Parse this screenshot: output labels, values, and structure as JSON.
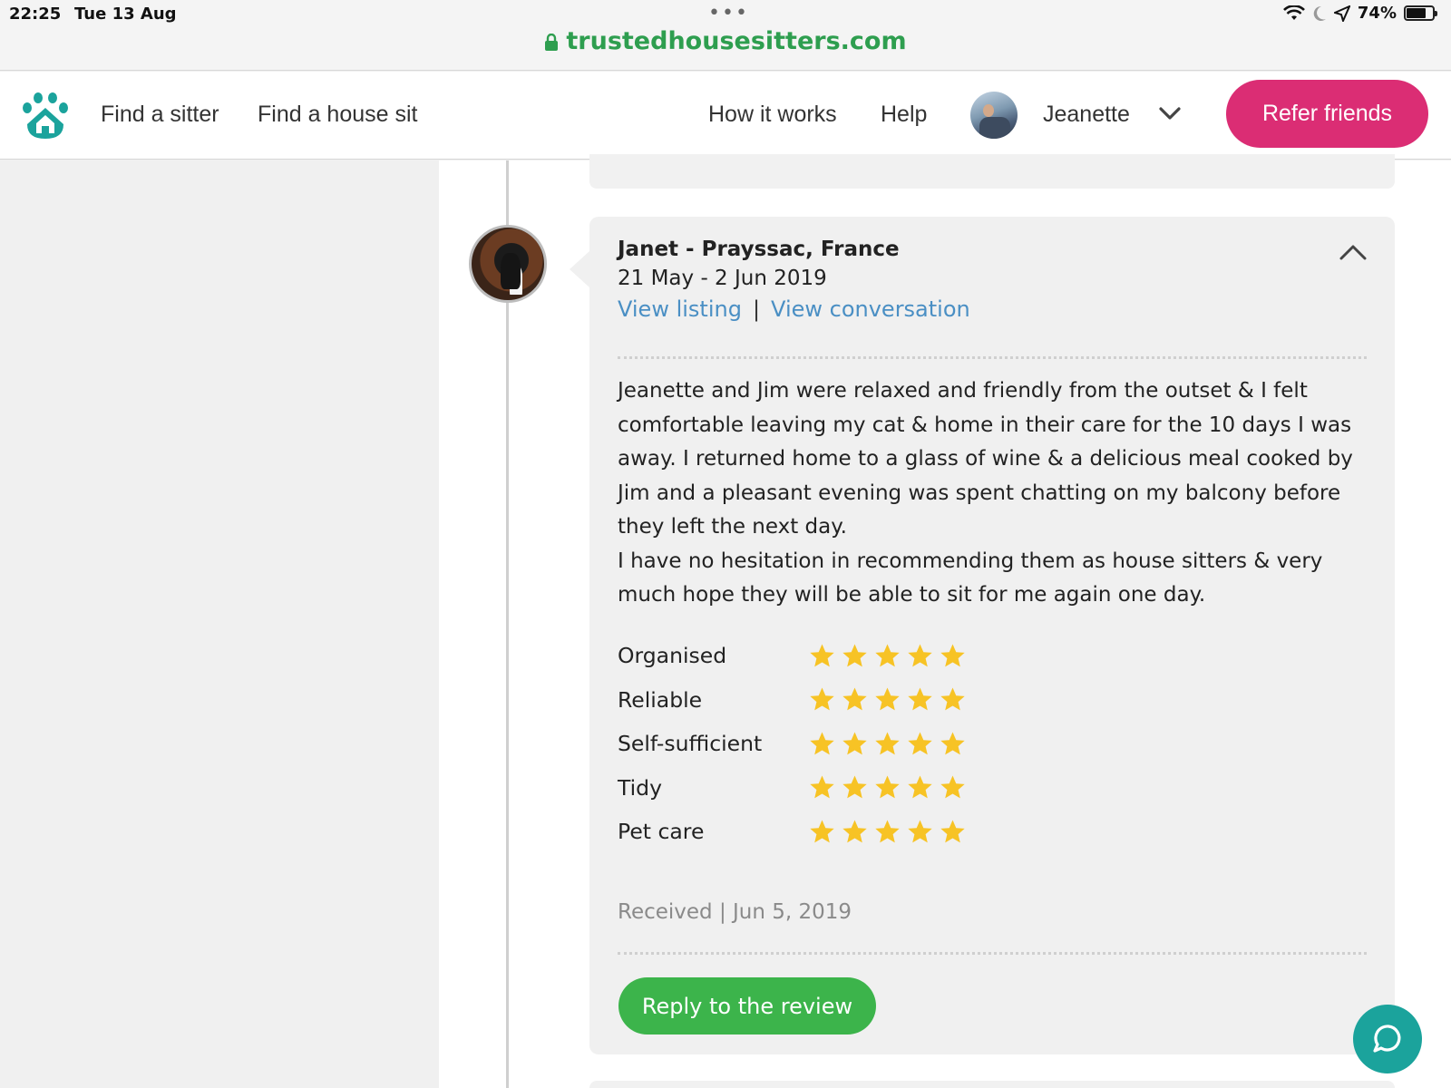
{
  "status_bar": {
    "time": "22:25",
    "date": "Tue 13 Aug",
    "dots": "•••",
    "battery": "74%",
    "battery_level": 0.74
  },
  "browser": {
    "url": "trustedhousesitters.com"
  },
  "nav": {
    "find_sitter": "Find a sitter",
    "find_house_sit": "Find a house sit",
    "how_it_works": "How it works",
    "help": "Help",
    "user_name": "Jeanette",
    "refer_friends": "Refer friends"
  },
  "review": {
    "title": "Janet - Prayssac, France",
    "dates": "21 May - 2 Jun 2019",
    "view_listing": "View listing",
    "separator": "|",
    "view_conversation": "View conversation",
    "body": [
      "Jeanette and Jim were relaxed and friendly from the outset & I felt comfortable leaving my cat & home in their care for the 10 days I was away. I returned home to a glass of wine & a delicious meal cooked by Jim and a pleasant evening was spent chatting on my balcony before they left the next day.",
      "I have no hesitation in recommending them as house sitters & very much hope they will be able to sit for me again one day."
    ],
    "ratings": [
      {
        "label": "Organised",
        "stars": 5
      },
      {
        "label": "Reliable",
        "stars": 5
      },
      {
        "label": "Self-sufficient",
        "stars": 5
      },
      {
        "label": "Tidy",
        "stars": 5
      },
      {
        "label": "Pet care",
        "stars": 5
      }
    ],
    "received": "Received | Jun 5, 2019",
    "reply_button": "Reply to the review"
  },
  "colors": {
    "brand_teal": "#1ba39c",
    "refer_pink": "#db2d74",
    "reply_green": "#3cb44b",
    "link_blue": "#4a8fc4",
    "star_yellow": "#f7c325",
    "url_green": "#2e9e4f"
  },
  "icons": [
    "paw-house-logo-icon",
    "lock-icon",
    "chevron-down-icon",
    "chevron-up-icon",
    "star-icon",
    "chat-bubble-icon",
    "wifi-icon",
    "moon-icon",
    "location-arrow-icon",
    "battery-icon"
  ]
}
